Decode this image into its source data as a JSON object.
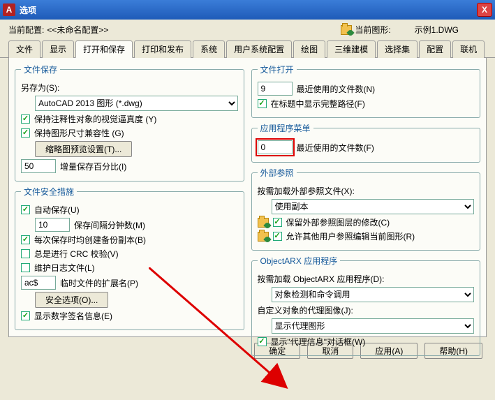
{
  "window": {
    "title": "选项",
    "close": "X"
  },
  "top": {
    "currentProfileLabel": "当前配置:",
    "currentProfileValue": "<<未命名配置>>",
    "currentDrawingLabel": "当前图形:",
    "currentDrawingValue": "示例1.DWG"
  },
  "tabs": [
    "文件",
    "显示",
    "打开和保存",
    "打印和发布",
    "系统",
    "用户系统配置",
    "绘图",
    "三维建模",
    "选择集",
    "配置",
    "联机"
  ],
  "left": {
    "fileSave": {
      "legend": "文件保存",
      "saveAsLabel": "另存为(S):",
      "saveAsValue": "AutoCAD 2013 图形 (*.dwg)",
      "annotVisual": "保持注释性对象的视觉逼真度 (Y)",
      "sizeCompat": "保持图形尺寸兼容性 (G)",
      "thumbBtn": "缩略图预览设置(T)...",
      "incSaveVal": "50",
      "incSaveLabel": "增量保存百分比(I)"
    },
    "safety": {
      "legend": "文件安全措施",
      "autoSave": "自动保存(U)",
      "autoSaveVal": "10",
      "autoSaveLabel": "保存间隔分钟数(M)",
      "backup": "每次保存时均创建备份副本(B)",
      "crc": "总是进行 CRC 校验(V)",
      "log": "维护日志文件(L)",
      "tempExtVal": "ac$",
      "tempExtLabel": "临时文件的扩展名(P)",
      "secOptBtn": "安全选项(O)...",
      "digSig": "显示数字签名信息(E)"
    }
  },
  "right": {
    "fileOpen": {
      "legend": "文件打开",
      "mruVal": "9",
      "mruLabel": "最近使用的文件数(N)",
      "fullPath": "在标题中显示完整路径(F)"
    },
    "appMenu": {
      "legend": "应用程序菜单",
      "mruVal": "0",
      "mruLabel": "最近使用的文件数(F)"
    },
    "xref": {
      "legend": "外部参照",
      "loadLabel": "按需加载外部参照文件(X):",
      "loadValue": "使用副本",
      "retain": "保留外部参照图层的修改(C)",
      "allowEdit": "允许其他用户参照编辑当前图形(R)"
    },
    "arx": {
      "legend": "ObjectARX 应用程序",
      "loadLabel": "按需加载 ObjectARX 应用程序(D):",
      "loadValue": "对象检测和命令调用",
      "proxyImgLabel": "自定义对象的代理图像(J):",
      "proxyImgValue": "显示代理图形",
      "proxyDlg": "显示\"代理信息\"对话框(W)"
    }
  },
  "footer": {
    "ok": "确定",
    "cancel": "取消",
    "apply": "应用(A)",
    "help": "帮助(H)"
  }
}
